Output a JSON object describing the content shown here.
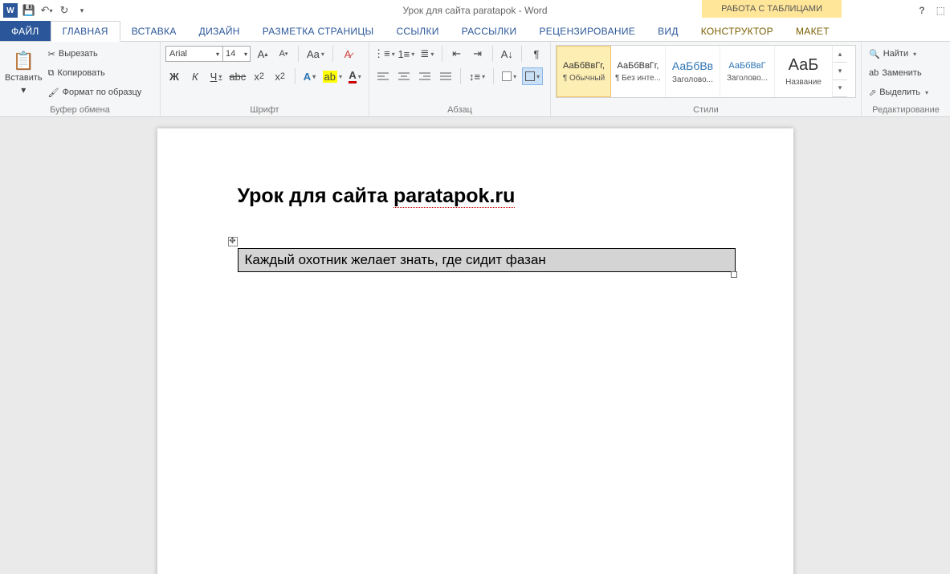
{
  "titlebar": {
    "title": "Урок для сайта paratapok - Word",
    "context_tab_title": "РАБОТА С ТАБЛИЦАМИ"
  },
  "tabs": {
    "file": "ФАЙЛ",
    "home": "ГЛАВНАЯ",
    "insert": "ВСТАВКА",
    "design": "ДИЗАЙН",
    "layout": "РАЗМЕТКА СТРАНИЦЫ",
    "references": "ССЫЛКИ",
    "mailings": "РАССЫЛКИ",
    "review": "РЕЦЕНЗИРОВАНИЕ",
    "view": "ВИД",
    "table_design": "КОНСТРУКТОР",
    "table_layout": "МАКЕТ"
  },
  "clipboard": {
    "paste": "Вставить",
    "cut": "Вырезать",
    "copy": "Копировать",
    "format_painter": "Формат по образцу",
    "group": "Буфер обмена"
  },
  "font": {
    "name": "Arial",
    "size": "14",
    "bold": "Ж",
    "italic": "К",
    "underline": "Ч",
    "strike": "abc",
    "sub": "x",
    "sup": "x",
    "group": "Шрифт"
  },
  "para": {
    "group": "Абзац"
  },
  "styles": {
    "group": "Стили",
    "items": [
      {
        "preview": "АаБбВвГг,",
        "name": "¶ Обычный"
      },
      {
        "preview": "АаБбВвГг,",
        "name": "¶ Без инте..."
      },
      {
        "preview": "АаБбВв",
        "name": "Заголово..."
      },
      {
        "preview": "АаБбВвГ",
        "name": "Заголово..."
      },
      {
        "preview": "АаБ",
        "name": "Название"
      }
    ]
  },
  "editing": {
    "find": "Найти",
    "replace": "Заменить",
    "select": "Выделить",
    "group": "Редактирование"
  },
  "document": {
    "heading_prefix": "Урок для сайта ",
    "heading_link": "paratapok.ru",
    "table_text": "Каждый охотник желает знать, где сидит фазан"
  }
}
